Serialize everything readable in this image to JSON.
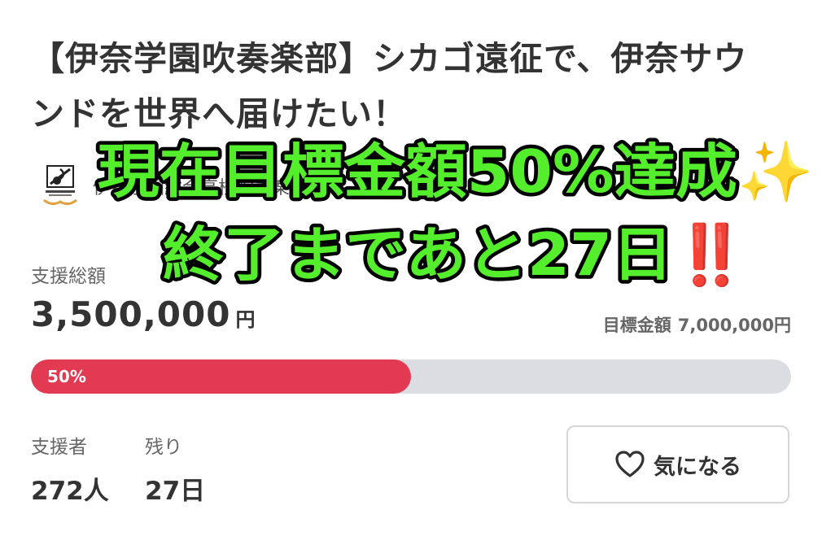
{
  "project": {
    "title": "【伊奈学園吹奏楽部】シカゴ遠征で、伊奈サウンドを世界へ届けたい！",
    "organizer_name": "伊奈学園総合高校吹奏楽部",
    "logo_icon": "school-band-emblem-icon"
  },
  "overlay": {
    "line1": "現在目標金額50%達成✨",
    "line2": "終了まであと27日‼️",
    "text_color": "#55ee2c",
    "outline_color": "#000000"
  },
  "funding": {
    "total_label": "支援総額",
    "total_amount": "3,500,000",
    "currency_unit": "円",
    "goal_label": "目標金額",
    "goal_amount": "7,000,000円",
    "progress_fraction": 0.5,
    "progress_label": "50%",
    "progress_color": "#e23a52",
    "track_color": "#dcdde2"
  },
  "stats": {
    "supporters_label": "支援者",
    "supporters_value": "272人",
    "remaining_label": "残り",
    "remaining_value": "27日"
  },
  "actions": {
    "watch_label": "気になる",
    "watch_icon": "heart-outline-icon"
  }
}
